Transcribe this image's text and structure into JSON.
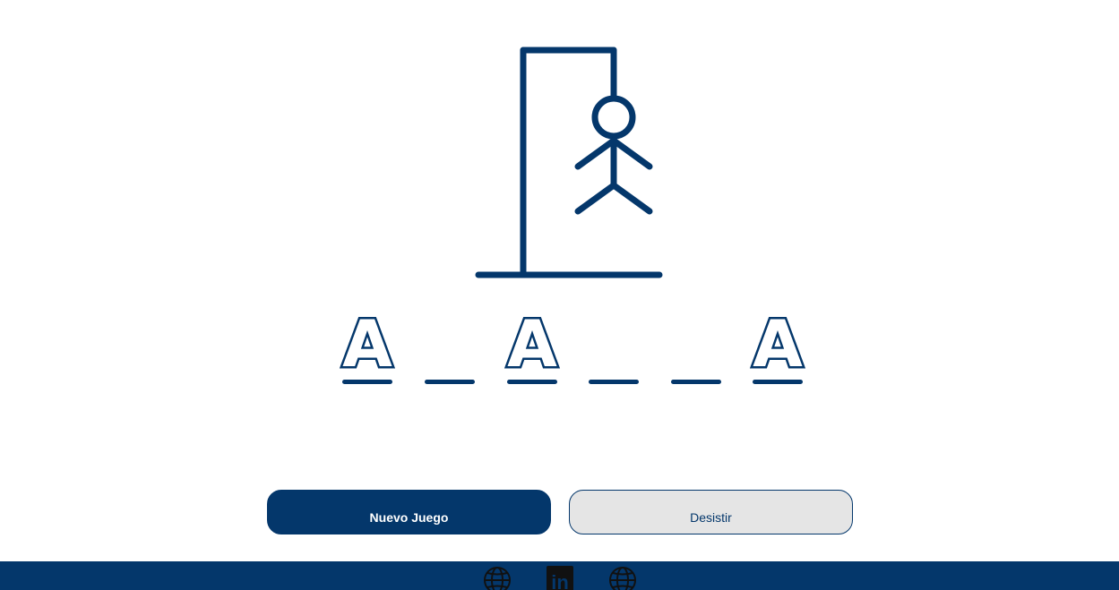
{
  "colors": {
    "primary": "#04376b",
    "secondary_bg": "#e5e5e5",
    "background": "#ffffff"
  },
  "game": {
    "letters": [
      "A",
      "",
      "A",
      "",
      "",
      "A"
    ],
    "hangman_parts_visible": [
      "head",
      "body",
      "left-arm",
      "right-arm",
      "left-leg",
      "right-leg"
    ]
  },
  "buttons": {
    "new_game": "Nuevo Juego",
    "give_up": "Desistir"
  },
  "footer": {
    "icons": [
      "globe-icon",
      "linkedin-icon",
      "globe-icon"
    ],
    "linkedin_text": "in"
  }
}
